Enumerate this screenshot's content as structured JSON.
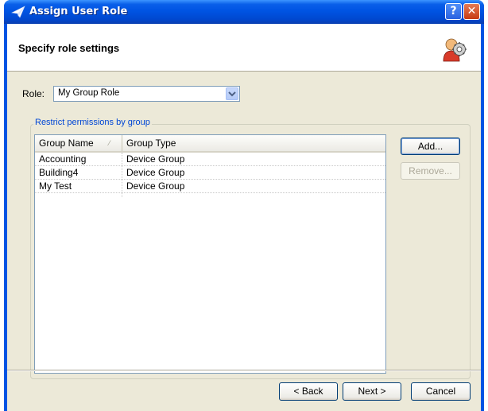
{
  "window": {
    "title": "Assign User Role",
    "help_glyph": "?",
    "close_glyph": "✕",
    "title_icon": "wizard-arrow-icon"
  },
  "header": {
    "title": "Specify role settings",
    "icon": "user-gear-icon"
  },
  "role": {
    "label": "Role:",
    "value": "My Group Role"
  },
  "group_box": {
    "label": "Restrict permissions by group"
  },
  "table": {
    "columns": [
      "Group Name",
      "Group Type"
    ],
    "rows": [
      [
        "Accounting",
        "Device Group"
      ],
      [
        "Building4",
        "Device Group"
      ],
      [
        "My Test",
        "Device Group"
      ]
    ]
  },
  "buttons": {
    "add": "Add...",
    "remove": "Remove...",
    "back": "< Back",
    "next": "Next >",
    "cancel": "Cancel"
  },
  "colors": {
    "title_bar": "#0054e3",
    "dialog_bg": "#ece9d8",
    "group_label": "#0046d5"
  }
}
